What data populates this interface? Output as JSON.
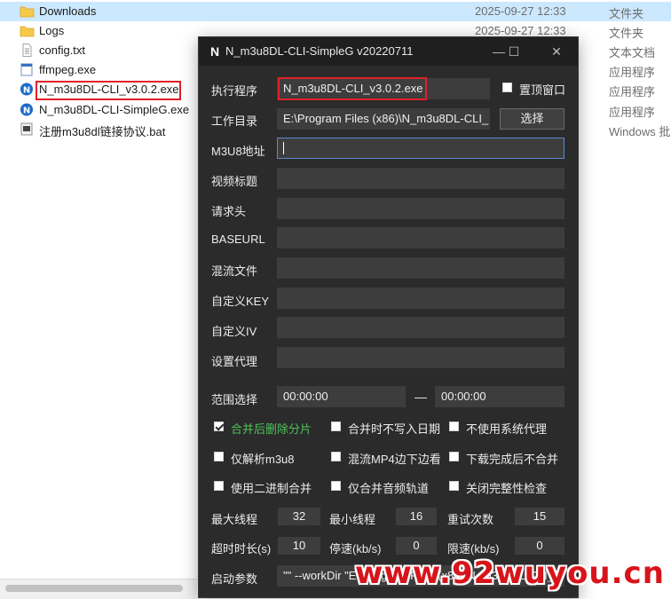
{
  "explorer": {
    "files": [
      {
        "name": "Downloads",
        "date": "2025-09-27 12:33",
        "type": "文件夹",
        "icon": "folder-icon"
      },
      {
        "name": "Logs",
        "date": "2025-09-27 12:33",
        "type": "文件夹",
        "icon": "folder-icon"
      },
      {
        "name": "config.txt",
        "date": "",
        "type": "文本文档",
        "icon": "text-file-icon"
      },
      {
        "name": "ffmpeg.exe",
        "date": "",
        "type": "应用程序",
        "icon": "exe-icon"
      },
      {
        "name": "N_m3u8DL-CLI_v3.0.2.exe",
        "date": "",
        "type": "应用程序",
        "icon": "n-app-icon"
      },
      {
        "name": "N_m3u8DL-CLI-SimpleG.exe",
        "date": "",
        "type": "应用程序",
        "icon": "n-app-icon"
      },
      {
        "name": "注册m3u8dl链接协议.bat",
        "date": "",
        "type": "Windows 批",
        "icon": "bat-file-icon"
      }
    ]
  },
  "window": {
    "title": "N_m3u8DL-CLI-SimpleG v20220711",
    "icon_letter": "N",
    "minimize": "—",
    "maximize": "☐",
    "close": "✕"
  },
  "form": {
    "exec_label": "执行程序",
    "exec_value": "N_m3u8DL-CLI_v3.0.2.exe",
    "topmost_label": "置顶窗口",
    "workdir_label": "工作目录",
    "workdir_value": "E:\\Program Files (x86)\\N_m3u8DL-CLI_",
    "select_button": "选择",
    "m3u8_label": "M3U8地址",
    "m3u8_value": "",
    "title_label": "视频标题",
    "header_label": "请求头",
    "baseurl_label": "BASEURL",
    "mux_label": "混流文件",
    "key_label": "自定义KEY",
    "iv_label": "自定义IV",
    "proxy_label": "设置代理",
    "range_label": "范围选择",
    "range_start": "00:00:00",
    "range_dash": "—",
    "range_end": "00:00:00"
  },
  "checkboxes": {
    "merge_delete": {
      "label": "合并后删除分片",
      "checked": true
    },
    "no_date": {
      "label": "合并时不写入日期",
      "checked": false
    },
    "no_sys_proxy": {
      "label": "不使用系统代理",
      "checked": false
    },
    "parse_only": {
      "label": "仅解析m3u8",
      "checked": false
    },
    "mux_mp4": {
      "label": "混流MP4边下边看",
      "checked": false
    },
    "no_merge": {
      "label": "下载完成后不合并",
      "checked": false
    },
    "binary_merge": {
      "label": "使用二进制合并",
      "checked": false
    },
    "audio_only": {
      "label": "仅合并音频轨道",
      "checked": false
    },
    "no_integrity": {
      "label": "关闭完整性检查",
      "checked": false
    }
  },
  "params": {
    "max_threads_label": "最大线程",
    "max_threads": "32",
    "min_threads_label": "最小线程",
    "min_threads": "16",
    "retry_label": "重试次数",
    "retry": "15",
    "timeout_label": "超时时长(s)",
    "timeout": "10",
    "stop_speed_label": "停速(kb/s)",
    "stop_speed": "0",
    "limit_speed_label": "限速(kb/s)",
    "limit_speed": "0",
    "launch_label": "启动参数",
    "launch_value": "\"\" --workDir \"E:\\Program Files (x86)\\N_m3u8DL-CLI_\""
  },
  "watermark": "www.92wuyou.cn"
}
